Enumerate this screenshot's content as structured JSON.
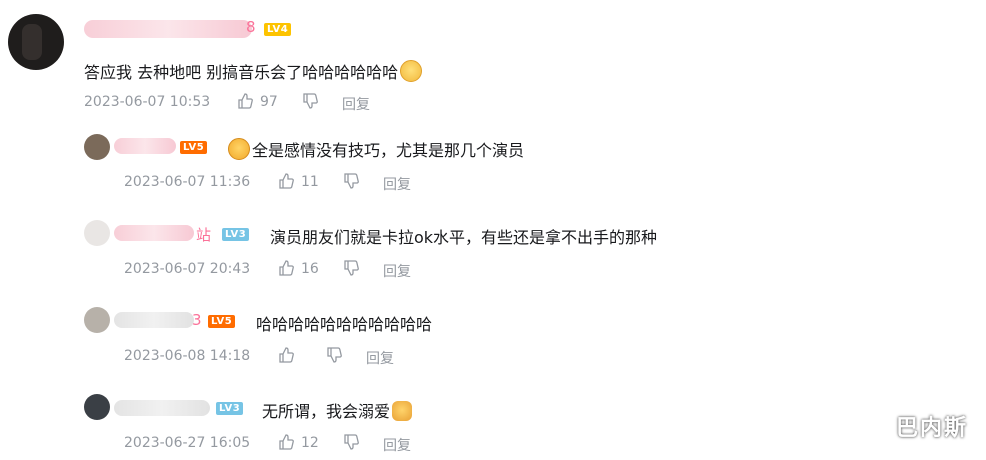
{
  "main_comment": {
    "name_suffix": "8",
    "level": "LV4",
    "text": "答应我 去种地吧 别搞音乐会了哈哈哈哈哈哈",
    "emoji": "blush-emoji",
    "time": "2023-06-07 10:53",
    "likes": "97",
    "reply_label": "回复"
  },
  "replies": [
    {
      "level": "LV5",
      "emoji": "crying-laugh-emoji",
      "text": "全是感情没有技巧，尤其是那几个演员",
      "time": "2023-06-07 11:36",
      "likes": "11",
      "reply_label": "回复"
    },
    {
      "name_suffix": "站",
      "level": "LV3",
      "text": "演员朋友们就是卡拉ok水平，有些还是拿不出手的那种",
      "time": "2023-06-07 20:43",
      "likes": "16",
      "reply_label": "回复"
    },
    {
      "name_suffix": "3",
      "level": "LV5",
      "text": "哈哈哈哈哈哈哈哈哈哈哈",
      "time": "2023-06-08 14:18",
      "likes": "",
      "reply_label": "回复"
    },
    {
      "level": "LV3",
      "text": "无所谓，我会溺爱",
      "emoji": "cat-emoji",
      "time": "2023-06-27 16:05",
      "likes": "12",
      "reply_label": "回复"
    }
  ],
  "watermark": "巴内斯"
}
